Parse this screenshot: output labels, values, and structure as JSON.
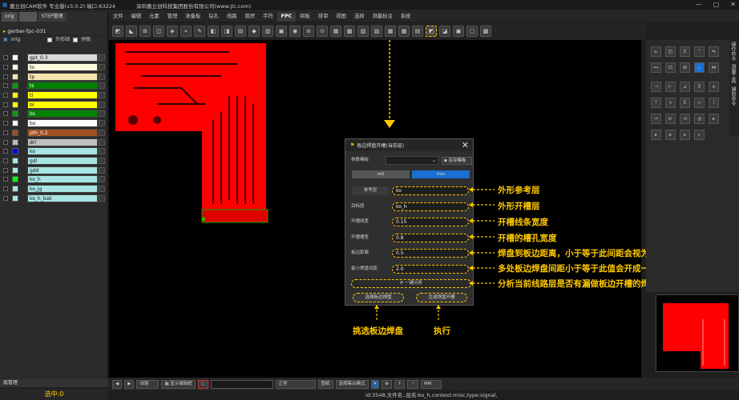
{
  "titlebar": {
    "app": "嘉立创CAM软件 专业版(v3.0.2) 端口:63224",
    "company": "深圳嘉立创科技集团股份有限公司(www.jlc.com)",
    "min": "—",
    "max": "▢",
    "close": "✕"
  },
  "menu": [
    "文件",
    "编辑",
    "元素",
    "管理",
    "准备板",
    "钻孔",
    "线路",
    "阻焊",
    "字符",
    "FPC",
    "拼板",
    "排审",
    "视图",
    "选择",
    "测量标注",
    "系统"
  ],
  "menu_active": "FPC",
  "left_panel": {
    "tabs": [
      "orig",
      "",
      "STEP管理"
    ],
    "project": "gerber-fpc-031",
    "step": "orig",
    "opt_outline": "外形线",
    "opt_panel": "拼板",
    "layers": [
      {
        "name": "gpt_0.3",
        "color": "#ffffff",
        "label_bg": "#d9d9d9"
      },
      {
        "name": "to",
        "color": "#fffce0",
        "label_bg": "#fffce0"
      },
      {
        "name": "tp",
        "color": "#f5e6b0",
        "label_bg": "#f5e6b0"
      },
      {
        "name": "ts",
        "color": "#00a000",
        "label_bg": "#008000"
      },
      {
        "name": "tl",
        "color": "#ffff00",
        "label_bg": "#ffff00"
      },
      {
        "name": "bl",
        "color": "#ffff00",
        "label_bg": "#ffff00"
      },
      {
        "name": "bs",
        "color": "#00a000",
        "label_bg": "#008000"
      },
      {
        "name": "bo",
        "color": "#ffffff",
        "label_bg": "#ffffff"
      },
      {
        "name": "pth_0.2",
        "color": "#a05020",
        "label_bg": "#a05020"
      },
      {
        "name": "drl",
        "color": "#bbbbbb",
        "label_bg": "#c0c0c0"
      },
      {
        "name": "ko",
        "color": "#0000ff",
        "label_bg": "#a8e4e4"
      },
      {
        "name": "gdl",
        "color": "#a8e4e4",
        "label_bg": "#a8e4e4"
      },
      {
        "name": "gdd",
        "color": "#a8e4e4",
        "label_bg": "#a8e4e4"
      },
      {
        "name": "ko_h",
        "color": "#00ff00",
        "label_bg": "#a8e4e4"
      },
      {
        "name": "ko_jg",
        "color": "#a8e4e4",
        "label_bg": "#a8e4e4"
      },
      {
        "name": "ko_h_bak",
        "color": "#a8e4e4",
        "label_bg": "#a8e4e4"
      }
    ],
    "bottom_tab": "层管理",
    "selected": "选中:0"
  },
  "dialog": {
    "title": "板边焊盘开槽(当前层)",
    "param_template_label": "参数模板",
    "save_template": "另存模板",
    "unit_mil": "mil",
    "unit_mm": "mm",
    "fields": [
      {
        "label": "参考层",
        "value": "ko"
      },
      {
        "label": "目标层",
        "value": "ko_h"
      },
      {
        "label": "开槽线宽",
        "value": "0.15"
      },
      {
        "label": "开槽槽宽",
        "value": "0.8"
      },
      {
        "label": "板边距离",
        "value": "0.5"
      },
      {
        "label": "最小焊盘间距",
        "value": "2.0"
      }
    ],
    "analyze_btn": "一键分析",
    "select_btn": "选择板边焊盘",
    "generate_btn": "生成焊盘开槽"
  },
  "annotations": {
    "a1": "外形参考层",
    "a2": "外形开槽层",
    "a3": "开槽线条宽度",
    "a4": "开槽的槽孔宽度",
    "a5": "焊盘到板边距离，小于等于此间距会视为板边焊盘",
    "a6": "多处板边焊盘间距小于等于此值会开成一个槽",
    "a7": "分析当前线路层是否有漏做板边开槽的焊盘",
    "a8": "挑选板边焊盘",
    "a9": "执行"
  },
  "right_tabs": [
    "操作命令",
    "测量工具",
    "辅助命令"
  ],
  "bottombar": {
    "mode": "线路",
    "view_btn": "显示编辑框",
    "dropdown": "正常",
    "btn2": "图纸",
    "select_mode": "选择集合模式",
    "unit": "MM"
  },
  "status": "id:3548,文件名:,层名:ko_h,context:misc,type:signal,"
}
